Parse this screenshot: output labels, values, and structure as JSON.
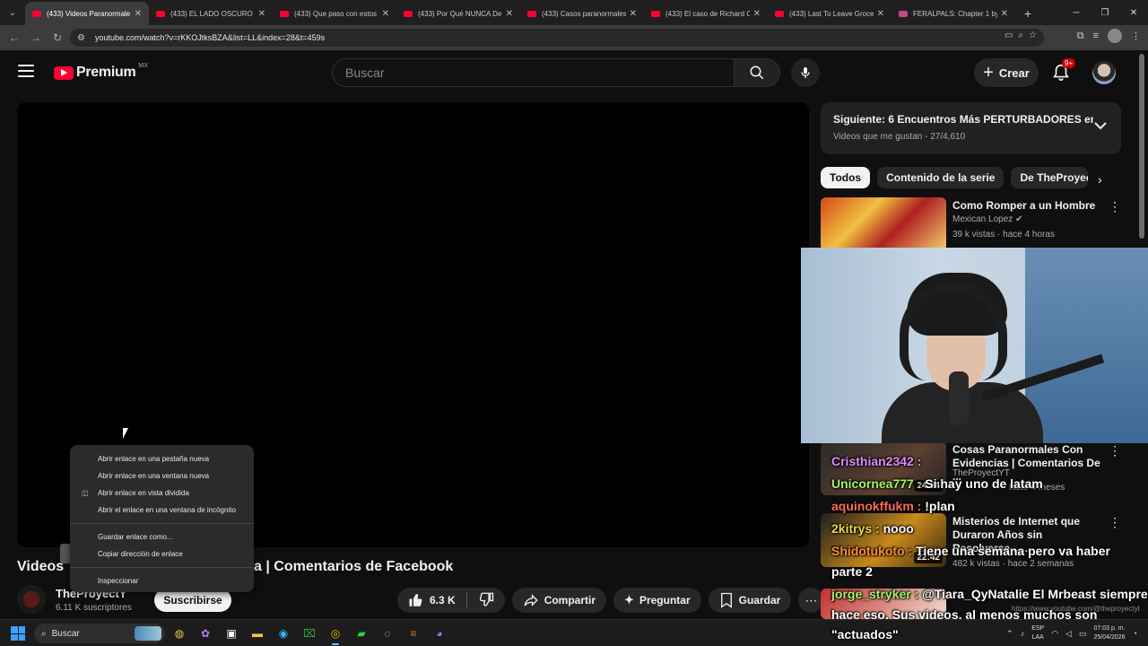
{
  "browser": {
    "tabs": [
      {
        "title": "(433) Videos Paranormale",
        "active": true
      },
      {
        "title": "(433) EL LADO OSCURO D",
        "active": false
      },
      {
        "title": "(433) Que paso con estos",
        "active": false
      },
      {
        "title": "(433) Por Qué NUNCA De",
        "active": false
      },
      {
        "title": "(433) Casos paranormales",
        "active": false
      },
      {
        "title": "(433) El caso de Richard C",
        "active": false
      },
      {
        "title": "(433) Last To Leave Groce",
        "active": false
      },
      {
        "title": "FERALPALS: Chapter 1 by",
        "active": false
      }
    ],
    "url": "youtube.com/watch?v=rKKOJtksBZA&list=LL&index=28&t=459s"
  },
  "header": {
    "logo_word": "Premium",
    "country_code": "MX",
    "search_placeholder": "Buscar",
    "create_label": "Crear",
    "notif_badge": "9+"
  },
  "context_menu": {
    "items": [
      "Abrir enlace en una pestaña nueva",
      "Abrir enlace en una ventana nueva",
      "Abrir enlace en vista dividida",
      "Abrir el enlace en una ventana de incógnito",
      "Guardar enlace como...",
      "Copiar dirección de enlace",
      "Inspeccionar"
    ]
  },
  "video": {
    "title_start": "Videos",
    "title_end": "a | Comentarios de Facebook",
    "channel": "TheProyectY",
    "subscribers": "6.11 K suscriptores",
    "subscribe_label": "Suscribirse",
    "likes": "6.3 K",
    "share_label": "Compartir",
    "ask_label": "Preguntar",
    "save_label": "Guardar"
  },
  "playlist": {
    "next_title": "Siguiente: 6 Encuentros Más PERTURBADORES en l...",
    "subtitle": "Videos que me gustan - 27/4,610"
  },
  "chips": [
    "Todos",
    "Contenido de la serie",
    "De TheProyectY"
  ],
  "recommendations": [
    {
      "title": "Como Romper a un Hombre",
      "channel": "Mexican Lopez",
      "meta": "39 k vistas · hace 4 horas"
    },
    {
      "title": "Cosas Paranormales Con Evidencias | Comentarios De ...",
      "channel": "TheProyectYT",
      "meta": "hace 4 meses",
      "duration": "24:34"
    },
    {
      "title": "Misterios de Internet que Duraron Años sin Resolverse......",
      "channel": "",
      "meta": "482 k vistas · hace 2 semanas",
      "duration": "22:42"
    }
  ],
  "chat": [
    {
      "user": "Cristhian2342 :",
      "msg": "",
      "color": "p"
    },
    {
      "user": "Unicornea777 :",
      "msg": "Si hay uno de latam",
      "color": "g"
    },
    {
      "user": "aquinokffukm :",
      "msg": "!plan",
      "color": "r"
    },
    {
      "user": "2kitrys :",
      "msg": "nooo",
      "color": "y"
    },
    {
      "user": "Shidotukoto :",
      "msg": "Tiene una semana pero va haber",
      "color": "o"
    },
    {
      "user": "",
      "msg": "parte 2",
      "color": "o"
    },
    {
      "user": "jorge_stryker :",
      "msg": "@Tiara_QyNatalie El Mrbeast siempre",
      "color": "g"
    },
    {
      "user": "",
      "msg": "hace eso. Sus videos, al menos muchos son",
      "color": "g"
    },
    {
      "user": "",
      "msg": "\"actuados\"",
      "color": "g"
    }
  ],
  "watermark": "https://www.youtube.com/@theproyectyt",
  "taskbar": {
    "search_label": "Buscar",
    "lang_top": "ESP",
    "lang_bottom": "LAA",
    "time": "07:03 p. m.",
    "date": "25/04/2026"
  }
}
